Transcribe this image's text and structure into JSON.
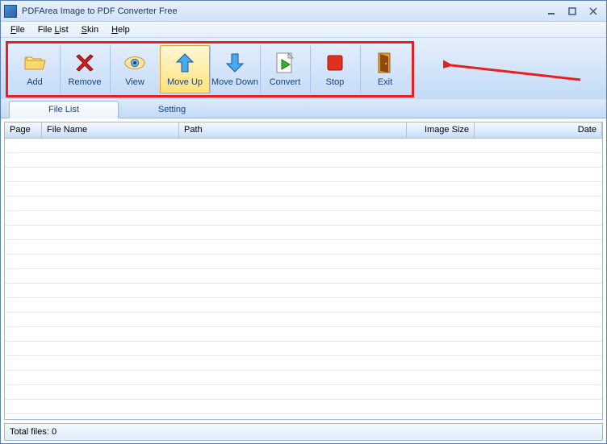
{
  "window": {
    "title": "PDFArea Image to PDF Converter Free"
  },
  "menu": {
    "file": "File",
    "filelist": "File List",
    "skin": "Skin",
    "help": "Help"
  },
  "toolbar": {
    "add": "Add",
    "remove": "Remove",
    "view": "View",
    "moveup": "Move Up",
    "movedown": "Move Down",
    "convert": "Convert",
    "stop": "Stop",
    "exit": "Exit"
  },
  "tabs": {
    "filelist": "File List",
    "setting": "Setting"
  },
  "columns": {
    "page": "Page",
    "filename": "File Name",
    "path": "Path",
    "imagesize": "Image Size",
    "date": "Date"
  },
  "status": {
    "totalfiles": "Total files: 0"
  }
}
